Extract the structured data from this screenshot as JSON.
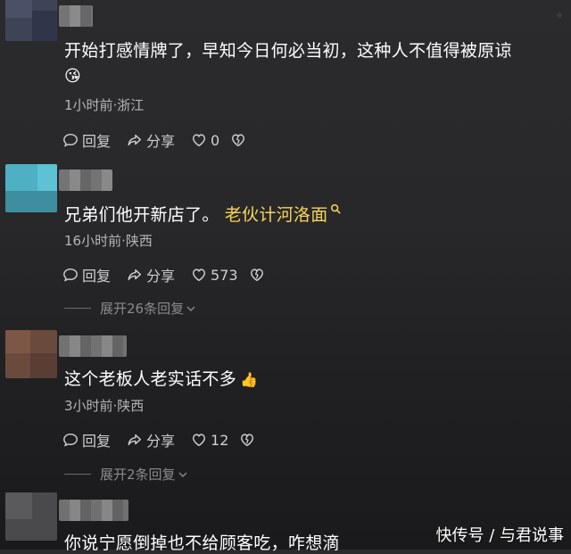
{
  "comments": [
    {
      "text": "开始打感情牌了，早知今日何必当初，这种人不值得被原谅",
      "emoji": "😘",
      "meta": "1小时前·浙江",
      "reply_label": "回复",
      "share_label": "分享",
      "like_count": "0"
    },
    {
      "text": "兄弟们他开新店了。",
      "link_text": "老伙计河洛面",
      "meta": "16小时前·陕西",
      "reply_label": "回复",
      "share_label": "分享",
      "like_count": "573",
      "expand_label": "展开26条回复"
    },
    {
      "text": "这个老板人老实话不多",
      "emoji": "👍",
      "meta": "3小时前·陕西",
      "reply_label": "回复",
      "share_label": "分享",
      "like_count": "12",
      "expand_label": "展开2条回复"
    },
    {
      "text": "你说宁愿倒掉也不给顾客吃，咋想滴"
    }
  ],
  "watermark": "快传号 / 与君说事",
  "colors": {
    "background": "#28282a",
    "link": "#f6d35a",
    "meta": "#b5b5b8"
  }
}
